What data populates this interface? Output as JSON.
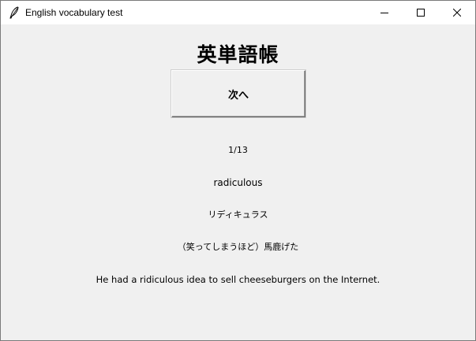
{
  "window": {
    "title": "English vocabulary test",
    "icon": "feather-icon",
    "controls": [
      "minimize-icon",
      "maximize-icon",
      "close-icon"
    ]
  },
  "main": {
    "heading": "英単語帳",
    "next_button_label": "次へ",
    "progress": "1/13",
    "word": "radiculous",
    "reading": "リディキュラス",
    "meaning": "（笑ってしまうほど）馬鹿げた",
    "example": "He had a ridiculous idea to sell cheeseburgers on the Internet."
  },
  "colors": {
    "window_background": "#f0f0f0",
    "titlebar_background": "#ffffff",
    "text": "#000000"
  }
}
